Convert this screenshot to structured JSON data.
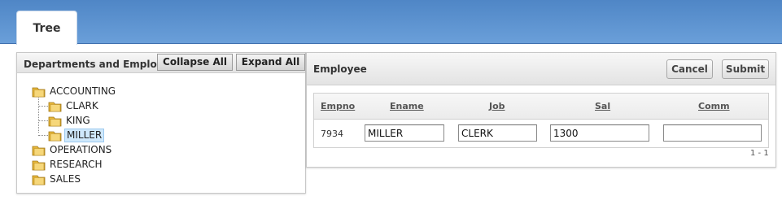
{
  "tabs": [
    {
      "label": "Tree"
    }
  ],
  "tree_panel": {
    "title": "Departments and Employees",
    "collapse_label": "Collapse All",
    "expand_label": "Expand All",
    "nodes": [
      {
        "label": "ACCOUNTING"
      },
      {
        "label": "CLARK"
      },
      {
        "label": "KING"
      },
      {
        "label": "MILLER",
        "selected": true
      },
      {
        "label": "OPERATIONS"
      },
      {
        "label": "RESEARCH"
      },
      {
        "label": "SALES"
      }
    ]
  },
  "employee_panel": {
    "title": "Employee",
    "cancel_label": "Cancel",
    "submit_label": "Submit",
    "columns": [
      "Empno",
      "Ename",
      "Job",
      "Sal",
      "Comm"
    ],
    "row": {
      "empno": "7934",
      "ename": "MILLER",
      "job": "CLERK",
      "sal": "1300",
      "comm": ""
    },
    "pagination": "1 - 1"
  },
  "colors": {
    "header_blue": "#5b8fcf",
    "selected_node": "#cfe8fb",
    "folder": "#e8b83a"
  }
}
